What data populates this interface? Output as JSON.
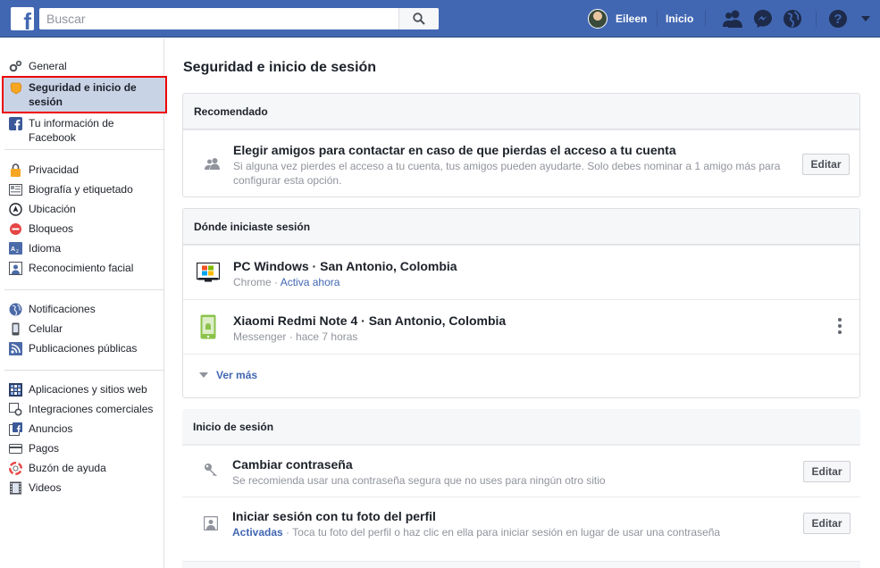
{
  "topbar": {
    "logo": "f",
    "search_placeholder": "Buscar",
    "search_icon": "search-icon",
    "user_name": "Eileen",
    "home_label": "Inicio",
    "icons": [
      "friend-requests-icon",
      "messenger-icon",
      "notifications-globe-icon",
      "help-icon",
      "dropdown-caret-icon"
    ],
    "brand_color": "#4267b2"
  },
  "sidebar": {
    "groups": [
      {
        "items": [
          {
            "label": "General",
            "icon": "gears-icon"
          },
          {
            "label": "Seguridad e inicio de sesión",
            "icon": "security-badge-icon",
            "active": true
          },
          {
            "label": "Tu información de Facebook",
            "icon": "facebook-icon"
          }
        ]
      },
      {
        "items": [
          {
            "label": "Privacidad",
            "icon": "lock-icon"
          },
          {
            "label": "Biografía y etiquetado",
            "icon": "timeline-icon"
          },
          {
            "label": "Ubicación",
            "icon": "location-icon"
          },
          {
            "label": "Bloqueos",
            "icon": "block-icon"
          },
          {
            "label": "Idioma",
            "icon": "language-icon"
          },
          {
            "label": "Reconocimiento facial",
            "icon": "face-icon"
          }
        ]
      },
      {
        "items": [
          {
            "label": "Notificaciones",
            "icon": "globe-icon"
          },
          {
            "label": "Celular",
            "icon": "mobile-icon"
          },
          {
            "label": "Publicaciones públicas",
            "icon": "rss-icon"
          }
        ]
      },
      {
        "items": [
          {
            "label": "Aplicaciones y sitios web",
            "icon": "apps-icon"
          },
          {
            "label": "Integraciones comerciales",
            "icon": "integrations-icon"
          },
          {
            "label": "Anuncios",
            "icon": "ads-icon"
          },
          {
            "label": "Pagos",
            "icon": "card-icon"
          },
          {
            "label": "Buzón de ayuda",
            "icon": "lifebuoy-icon"
          },
          {
            "label": "Videos",
            "icon": "film-icon"
          }
        ]
      }
    ]
  },
  "main": {
    "title": "Seguridad e inicio de sesión",
    "recommended": {
      "heading": "Recomendado",
      "title": "Elegir amigos para contactar en caso de que pierdas el acceso a tu cuenta",
      "description": "Si alguna vez pierdes el acceso a tu cuenta, tus amigos pueden ayudarte. Solo debes nominar a 1 amigo más para configurar esta opción.",
      "edit_label": "Editar",
      "icon": "friends-icon"
    },
    "sessions": {
      "heading": "Dónde iniciaste sesión",
      "items": [
        {
          "device": "PC Windows",
          "location": "San Antonio, Colombia",
          "app": "Chrome",
          "status": "Activa ahora",
          "icon": "windows-pc-icon"
        },
        {
          "device": "Xiaomi Redmi Note 4",
          "location": "San Antonio, Colombia",
          "app": "Messenger",
          "status": "hace 7 horas",
          "icon": "android-phone-icon"
        }
      ],
      "see_more": "Ver más",
      "separator": " · "
    },
    "login": {
      "heading": "Inicio de sesión",
      "items": [
        {
          "title": "Cambiar contraseña",
          "description": "Se recomienda usar una contraseña segura que no uses para ningún otro sitio",
          "edit_label": "Editar",
          "icon": "key-icon"
        },
        {
          "title": "Iniciar sesión con tu foto del perfil",
          "status": "Activadas",
          "description": " · Toca tu foto del perfil o haz clic en ella para iniciar sesión en lugar de usar una contraseña",
          "edit_label": "Editar",
          "icon": "profile-photo-icon"
        }
      ]
    }
  }
}
